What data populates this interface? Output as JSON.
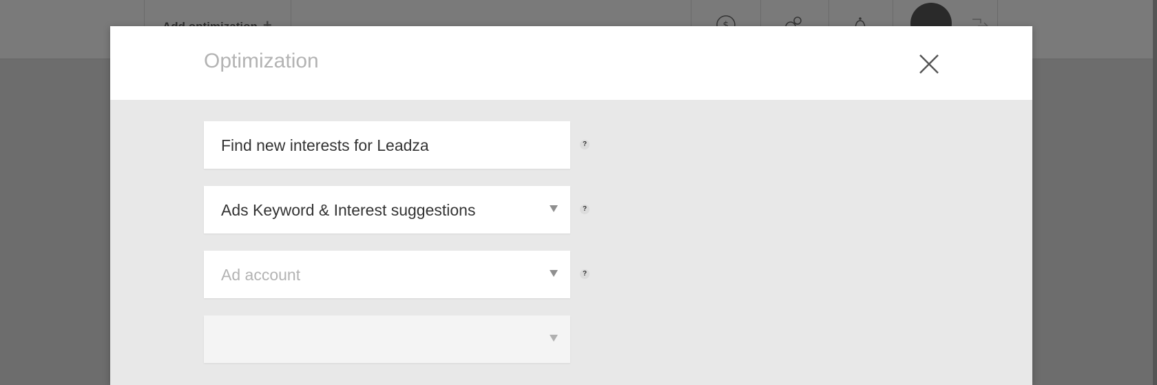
{
  "header": {
    "add_optimization_label": "Add optimization",
    "add_icon": "+",
    "icons": [
      "billing-icon",
      "settings-icon",
      "notifications-icon",
      "avatar",
      "logout-icon"
    ]
  },
  "modal": {
    "title": "Optimization",
    "close_icon": "close-icon",
    "fields": {
      "name_value": "Find new interests for Leadza",
      "type_value": "Ads Keyword & Interest suggestions",
      "ad_account_placeholder": "Ad account",
      "fourth_value": ""
    },
    "help_glyph": "?"
  },
  "colors": {
    "overlay": "#6f6f6f",
    "modal_body": "#e8e8e8",
    "modal_header": "#ffffff",
    "title_text": "#b3b3b3",
    "field_text": "#333333"
  }
}
